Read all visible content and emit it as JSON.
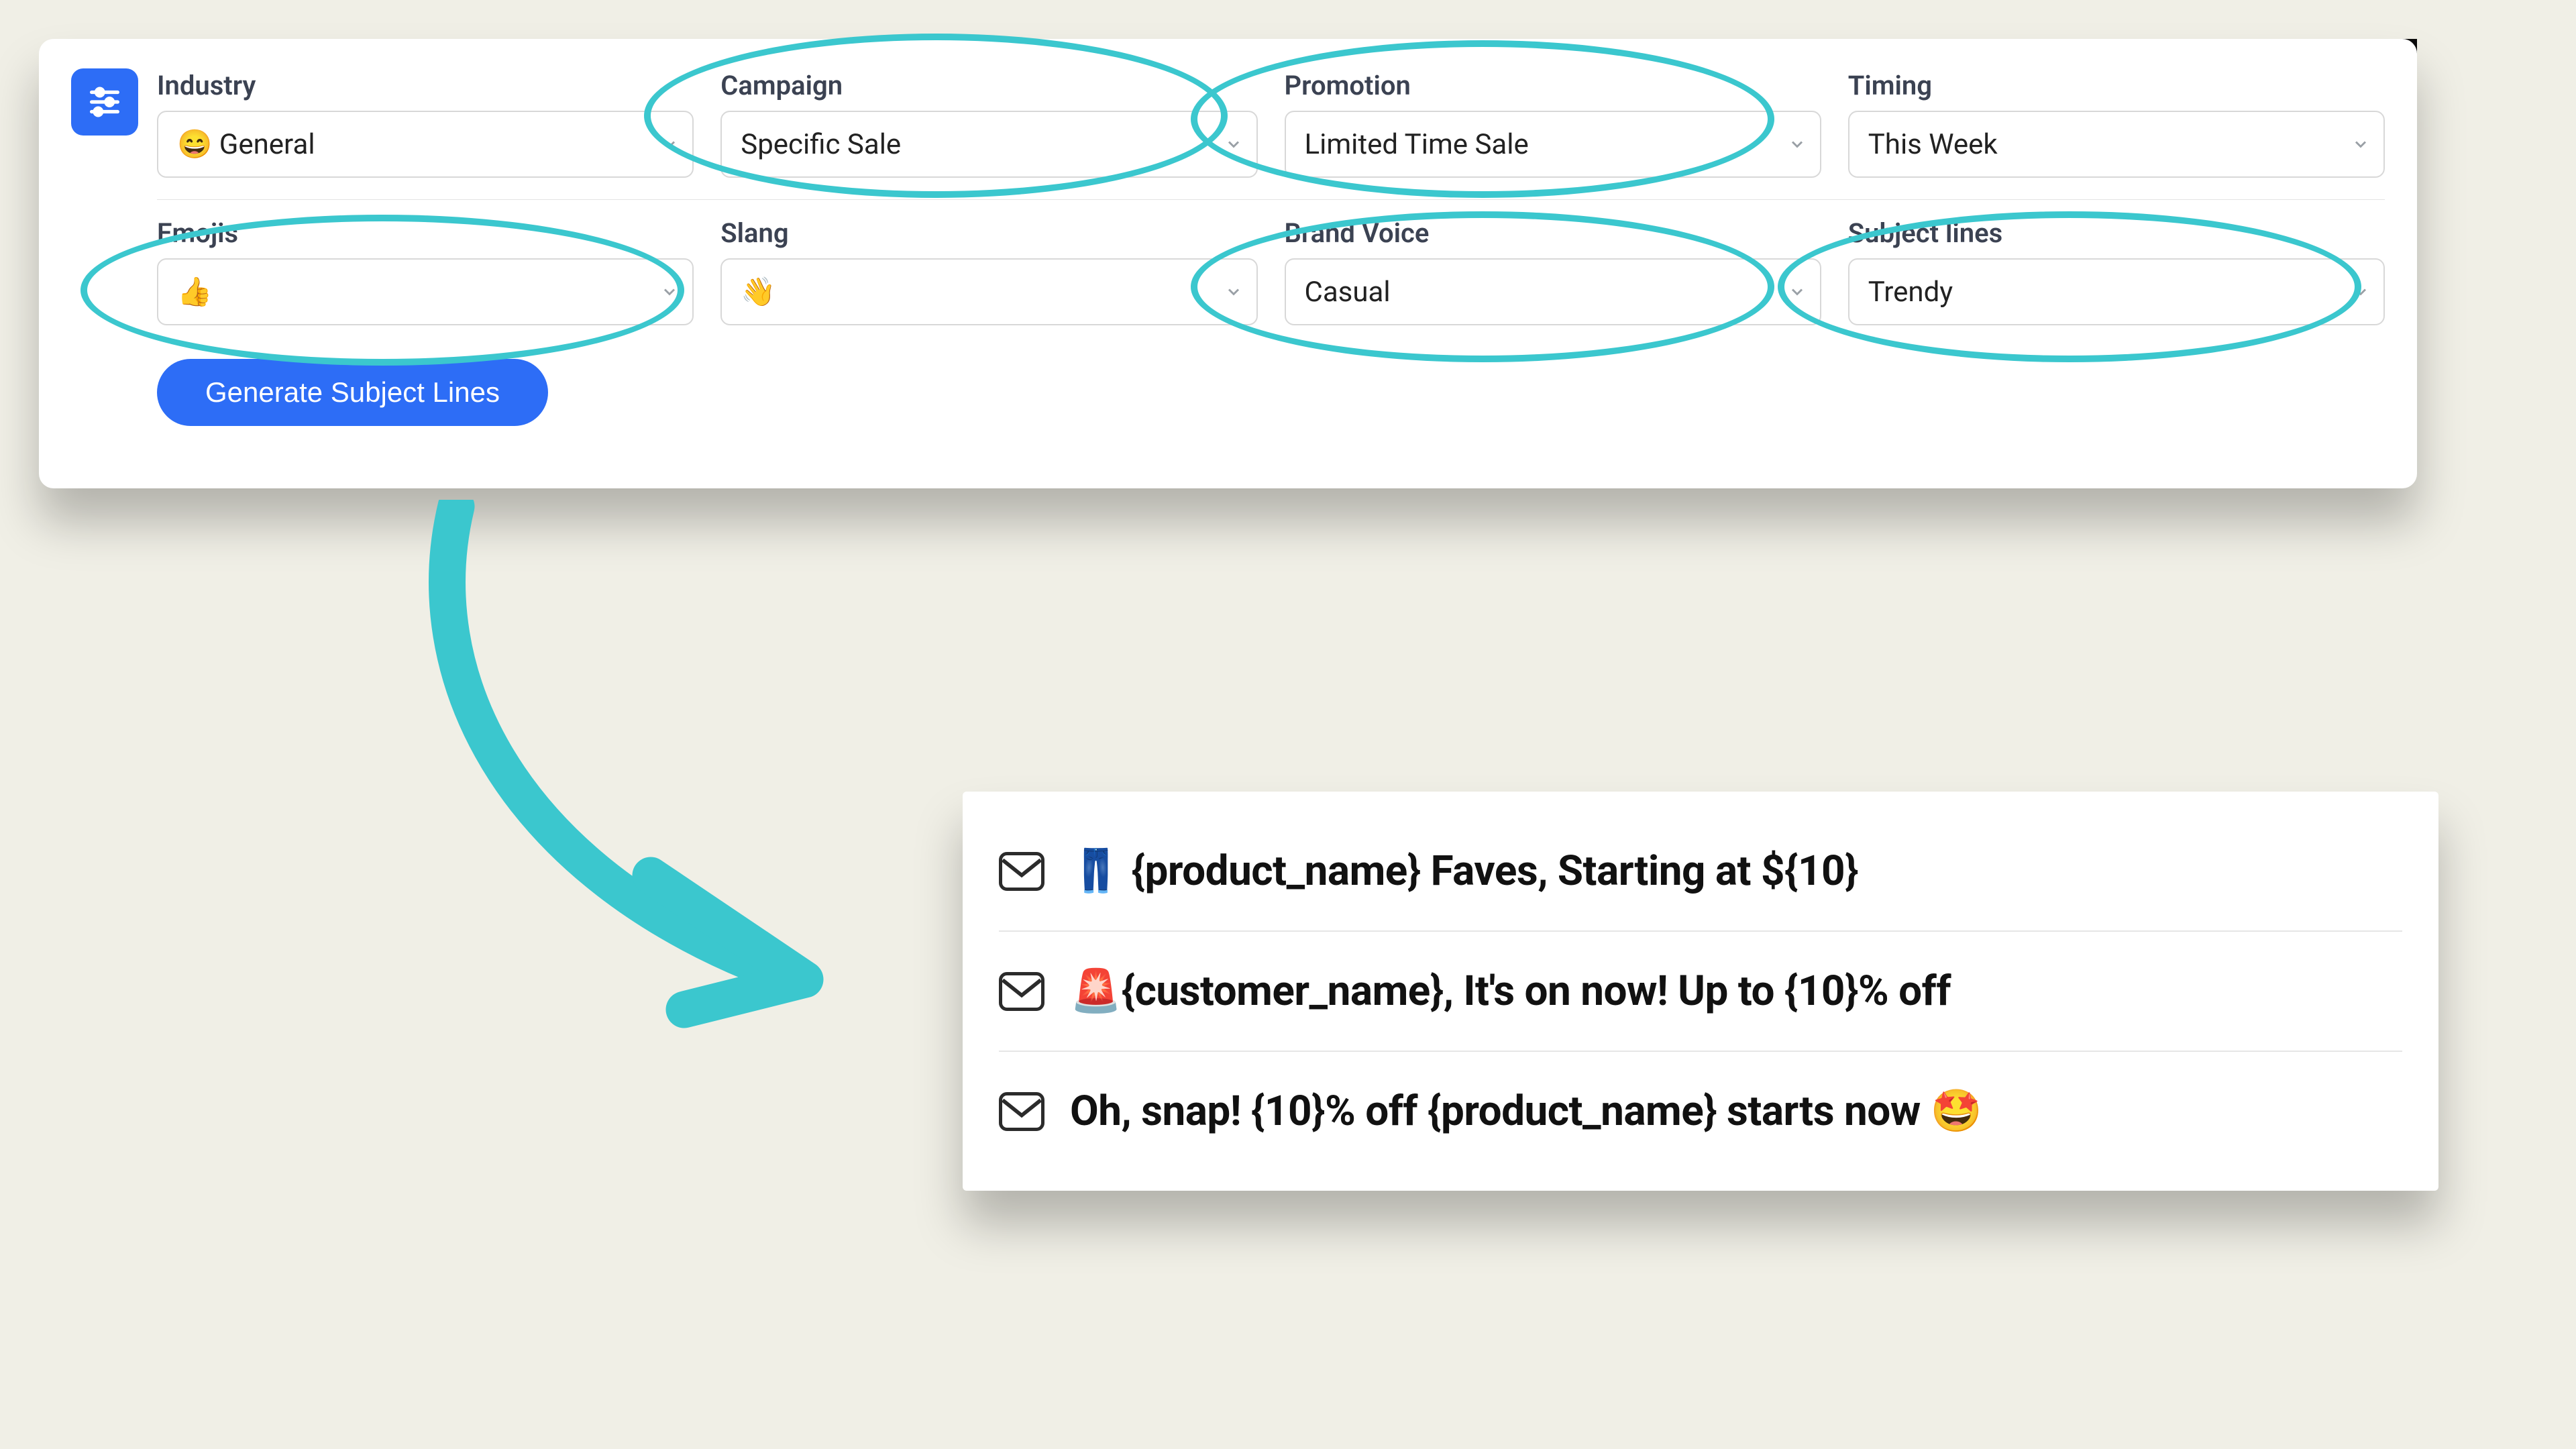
{
  "settings": {
    "row1": [
      {
        "label": "Industry",
        "value": "😄 General"
      },
      {
        "label": "Campaign",
        "value": "Specific Sale"
      },
      {
        "label": "Promotion",
        "value": "Limited Time Sale"
      },
      {
        "label": "Timing",
        "value": "This Week"
      }
    ],
    "row2": [
      {
        "label": "Emojis",
        "value": "👍"
      },
      {
        "label": "Slang",
        "value": "👋"
      },
      {
        "label": "Brand Voice",
        "value": "Casual"
      },
      {
        "label": "Subject lines",
        "value": "Trendy"
      }
    ],
    "generate_label": "Generate Subject Lines"
  },
  "highlights": {
    "ellipses": [
      "campaign",
      "promotion",
      "emojis",
      "brand-voice",
      "subject-lines"
    ],
    "accent": "#3bc7ce"
  },
  "results": [
    "👖 {product_name} Faves, Starting at ${10}",
    "🚨{customer_name}, It's on now! Up to {10}% off",
    "Oh, snap! {10}% off {product_name} starts now 🤩"
  ]
}
